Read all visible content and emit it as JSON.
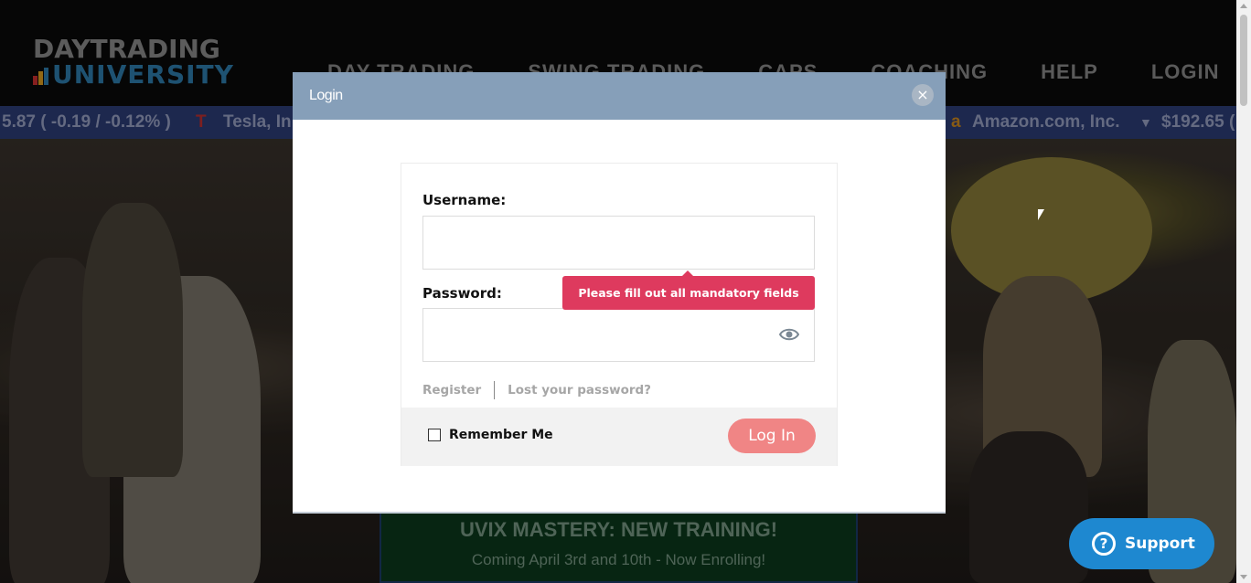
{
  "site": {
    "logo_top": "DAYTRADING",
    "logo_bottom": "UNIVERSITY",
    "nav": [
      "DAY TRADING",
      "SWING TRADING",
      "CAPS",
      "COACHING",
      "HELP",
      "LOGIN"
    ]
  },
  "ticker": {
    "left_text": "5.87 ( -0.19 / -0.12% )",
    "left_company": "Tesla, In",
    "right_company": "Amazon.com, Inc.",
    "right_price": "$192.65 ("
  },
  "promo": {
    "title": "UVIX MASTERY: NEW TRAINING!",
    "subtitle": "Coming April 3rd and 10th - Now Enrolling!"
  },
  "modal": {
    "title": "Login",
    "close_glyph": "×",
    "username_label": "Username:",
    "password_label": "Password:",
    "tooltip": "Please fill out all mandatory fields",
    "register_link": "Register",
    "lost_password_link": "Lost your password?",
    "remember_me": "Remember Me",
    "login_button": "Log In"
  },
  "support": {
    "label": "Support",
    "icon_glyph": "?"
  },
  "colors": {
    "modal_header": "#869fb9",
    "tooltip": "#de3a5e",
    "login_button": "#f08585",
    "support_button": "#1e88d0"
  }
}
